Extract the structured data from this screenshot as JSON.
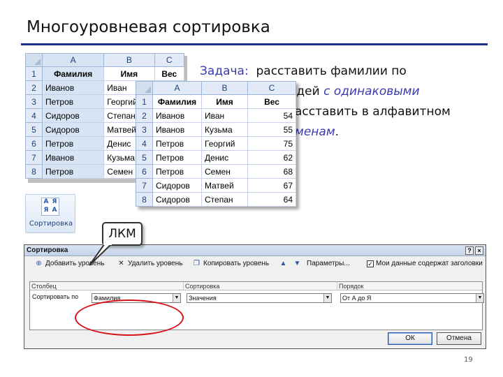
{
  "slide": {
    "title": "Многоуровневая сортировка",
    "page_number": "19"
  },
  "task": {
    "label": "Задача:",
    "line1": "расставить фамилии по",
    "line2_visible": "одей",
    "line2_em": "с одинаковыми",
    "line3_visible": "асставить в алфавитном",
    "line4_em": "менам",
    "line4_end": "."
  },
  "sheet_back": {
    "columns": [
      "A",
      "B",
      "C"
    ],
    "headers": [
      "Фамилия",
      "Имя",
      "Вес"
    ],
    "rows": [
      {
        "n": "1",
        "a": "Фамилия",
        "b": "Имя",
        "c": "Вес"
      },
      {
        "n": "2",
        "a": "Иванов",
        "b": "Иван"
      },
      {
        "n": "3",
        "a": "Петров",
        "b": "Георгий"
      },
      {
        "n": "4",
        "a": "Сидоров",
        "b": "Степан"
      },
      {
        "n": "5",
        "a": "Сидоров",
        "b": "Матвей"
      },
      {
        "n": "6",
        "a": "Петров",
        "b": "Денис"
      },
      {
        "n": "7",
        "a": "Иванов",
        "b": "Кузьма"
      },
      {
        "n": "8",
        "a": "Петров",
        "b": "Семен"
      }
    ]
  },
  "sheet_front": {
    "columns": [
      "A",
      "B",
      "C"
    ],
    "rows": [
      {
        "n": "1",
        "a": "Фамилия",
        "b": "Имя",
        "c": "Вес"
      },
      {
        "n": "2",
        "a": "Иванов",
        "b": "Иван",
        "c": "54"
      },
      {
        "n": "3",
        "a": "Иванов",
        "b": "Кузьма",
        "c": "55"
      },
      {
        "n": "4",
        "a": "Петров",
        "b": "Георгий",
        "c": "75"
      },
      {
        "n": "5",
        "a": "Петров",
        "b": "Денис",
        "c": "62"
      },
      {
        "n": "6",
        "a": "Петров",
        "b": "Семен",
        "c": "68"
      },
      {
        "n": "7",
        "a": "Сидоров",
        "b": "Матвей",
        "c": "67"
      },
      {
        "n": "8",
        "a": "Сидоров",
        "b": "Степан",
        "c": "64"
      }
    ]
  },
  "sort_tool": {
    "label": "Сортировка",
    "icon": "sort-az-icon",
    "glyphs": [
      "А",
      "Я",
      "Я",
      "А"
    ]
  },
  "callout": {
    "text": "ЛКМ"
  },
  "dialog": {
    "title": "Сортировка",
    "help": "?",
    "close": "×",
    "toolbar": {
      "add": "Добавить уровень",
      "delete": "Удалить уровень",
      "copy": "Копировать уровень",
      "params": "Параметры...",
      "has_headers": "Мои данные содержат заголовки",
      "has_headers_checked": true
    },
    "grid_headers": {
      "column": "Столбец",
      "sort_on": "Сортировка",
      "order": "Порядок"
    },
    "row": {
      "label": "Сортировать по",
      "column_value": "Фамилия",
      "sort_on_value": "Значения",
      "order_value": "От А до Я"
    },
    "ok": "ОК",
    "cancel": "Отмена"
  },
  "colors": {
    "title_rule": "#1c2f8c",
    "accent_text": "#3a3ab0",
    "ellipse": "#d8121b"
  }
}
